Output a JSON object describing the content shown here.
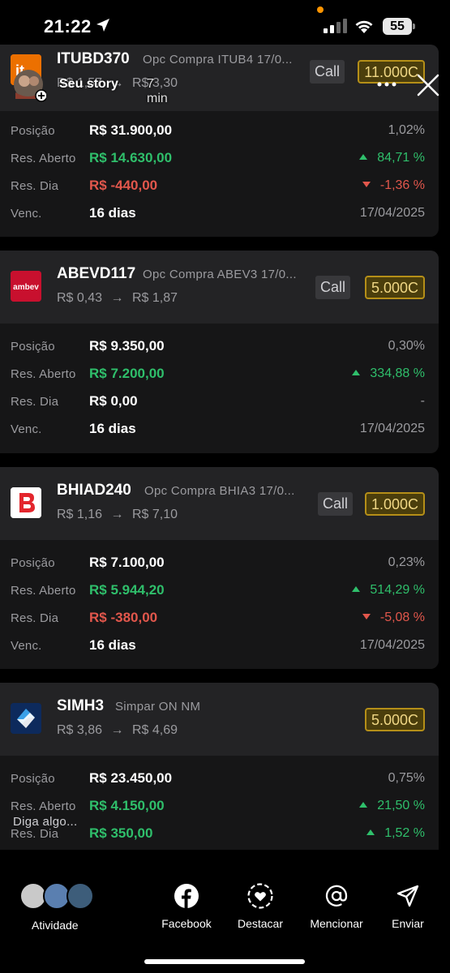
{
  "status_bar": {
    "time": "21:22",
    "battery": "55"
  },
  "story": {
    "user_label": "Seu story",
    "time_ago": "7 min",
    "progress": 1.0
  },
  "cards": [
    {
      "ticker": "ITUBD370",
      "description": "Opc Compra ITUB4 17/0...",
      "price_from": "R$ 1,57",
      "price_to": "R$ 3,30",
      "arrow": "→",
      "type": "Call",
      "quantity": "11.000C",
      "rows": [
        {
          "label": "Posição",
          "value": "R$ 31.900,00",
          "pct": "1,02%",
          "trend": "none",
          "value_color": "white"
        },
        {
          "label": "Res. Aberto",
          "value": "R$ 14.630,00",
          "pct": "84,71 %",
          "trend": "up",
          "value_color": "green"
        },
        {
          "label": "Res. Dia",
          "value": "R$ -440,00",
          "pct": "-1,36 %",
          "trend": "down",
          "value_color": "red"
        },
        {
          "label": "Venc.",
          "value": "16 dias",
          "pct": "17/04/2025",
          "trend": "none",
          "value_color": "white"
        }
      ]
    },
    {
      "ticker": "ABEVD117",
      "description": "Opc Compra ABEV3 17/0...",
      "price_from": "R$ 0,43",
      "price_to": "R$ 1,87",
      "arrow": "→",
      "type": "Call",
      "quantity": "5.000C",
      "logo_text": "ambev",
      "rows": [
        {
          "label": "Posição",
          "value": "R$ 9.350,00",
          "pct": "0,30%",
          "trend": "none",
          "value_color": "white"
        },
        {
          "label": "Res. Aberto",
          "value": "R$ 7.200,00",
          "pct": "334,88 %",
          "trend": "up",
          "value_color": "green"
        },
        {
          "label": "Res. Dia",
          "value": "R$ 0,00",
          "pct": "-",
          "trend": "none",
          "value_color": "white"
        },
        {
          "label": "Venc.",
          "value": "16 dias",
          "pct": "17/04/2025",
          "trend": "none",
          "value_color": "white"
        }
      ]
    },
    {
      "ticker": "BHIAD240",
      "description": "Opc Compra BHIA3 17/0...",
      "price_from": "R$ 1,16",
      "price_to": "R$ 7,10",
      "arrow": "→",
      "type": "Call",
      "quantity": "1.000C",
      "rows": [
        {
          "label": "Posição",
          "value": "R$ 7.100,00",
          "pct": "0,23%",
          "trend": "none",
          "value_color": "white"
        },
        {
          "label": "Res. Aberto",
          "value": "R$ 5.944,20",
          "pct": "514,29 %",
          "trend": "up",
          "value_color": "green"
        },
        {
          "label": "Res. Dia",
          "value": "R$ -380,00",
          "pct": "-5,08 %",
          "trend": "down",
          "value_color": "red"
        },
        {
          "label": "Venc.",
          "value": "16 dias",
          "pct": "17/04/2025",
          "trend": "none",
          "value_color": "white"
        }
      ]
    },
    {
      "ticker": "SIMH3",
      "description": "Simpar ON NM",
      "price_from": "R$ 3,86",
      "price_to": "R$ 4,69",
      "arrow": "→",
      "type": "",
      "quantity": "5.000C",
      "rows": [
        {
          "label": "Posição",
          "value": "R$ 23.450,00",
          "pct": "0,75%",
          "trend": "none",
          "value_color": "white"
        },
        {
          "label": "Res. Aberto",
          "value": "R$ 4.150,00",
          "pct": "21,50 %",
          "trend": "up",
          "value_color": "green"
        },
        {
          "label": "Res. Dia",
          "value": "R$ 350,00",
          "pct": "1,52 %",
          "trend": "up",
          "value_color": "green"
        }
      ]
    }
  ],
  "reply_placeholder": "Diga algo...",
  "bottom_actions": {
    "activity": "Atividade",
    "facebook": "Facebook",
    "highlight": "Destacar",
    "mention": "Mencionar",
    "send": "Enviar"
  },
  "colors": {
    "green": "#2fbf6b",
    "red": "#e2574c",
    "badge_gold": "#b58f18"
  }
}
